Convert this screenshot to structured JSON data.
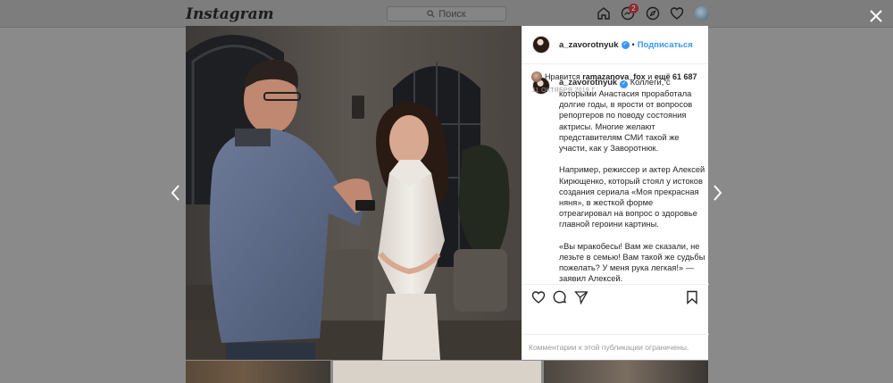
{
  "background": {
    "logo": "Instagram",
    "search_placeholder": "Поиск",
    "badge_count": "2"
  },
  "post": {
    "username": "a_zavorotnyuk",
    "separator": "•",
    "follow_label": "Подписаться",
    "caption_intro": "Коллеги, с которыми Анастасия проработала долгие годы, в ярости от вопросов репортеров по поводу состояния актрисы. Многие желают представителям СМИ такой же участи, как у Заворотнюк.",
    "caption_p2": "Например, режиссер и актер Алексей Кирющенко, который стоял у истоков создания сериала «Моя прекрасная няня», в жесткой форме отреагировал на вопрос о здоровье главной героини картины.",
    "caption_p3": "«Вы мракобесы! Вам же сказали, не лезьте в семью! Вам такой же судьбы пожелать? У меня рука легкая!» — заявил Алексей.",
    "likes_prefix": "Нравится",
    "liked_by": "ramazanova_fox",
    "likes_joiner": "и",
    "likes_more": "ещё 61 687",
    "date": "11 ОКТЯБРЯ 2019 Г.",
    "comments_disabled": "Комментарии к этой публикации ограничены."
  },
  "icons": {
    "close": "close-icon",
    "prev": "chevron-left-icon",
    "next": "chevron-right-icon",
    "like": "heart-icon",
    "comment": "comment-icon",
    "share": "paper-plane-icon",
    "save": "bookmark-icon"
  }
}
